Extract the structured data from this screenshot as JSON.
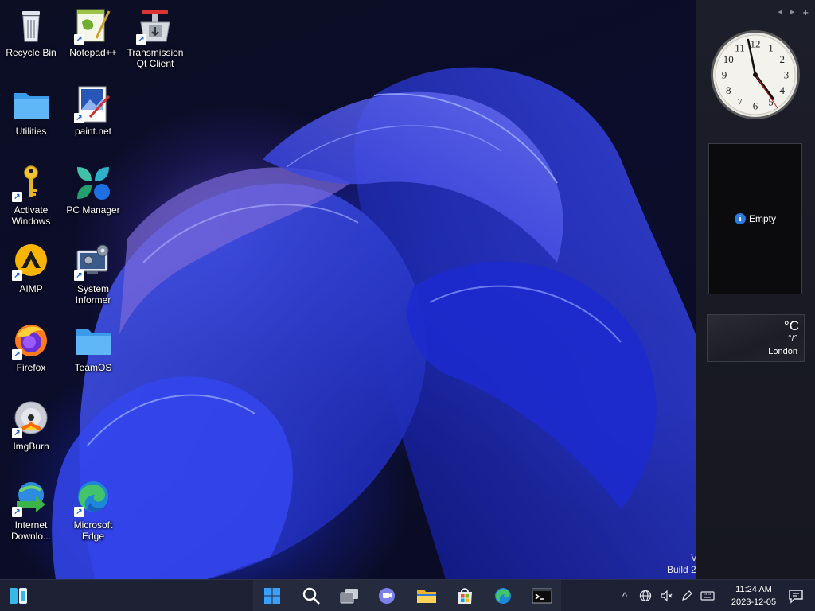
{
  "desktop": {
    "icons": [
      {
        "label": "Recycle Bin",
        "icon": "recycle-bin-icon"
      },
      {
        "label": "Notepad++",
        "icon": "notepad-plus-plus-icon"
      },
      {
        "label": "Transmission Qt Client",
        "icon": "transmission-icon"
      },
      {
        "label": "Utilities",
        "icon": "folder-icon"
      },
      {
        "label": "paint.net",
        "icon": "paint-net-icon"
      },
      {
        "label": "Activate Windows",
        "icon": "key-icon"
      },
      {
        "label": "PC Manager",
        "icon": "pc-manager-icon"
      },
      {
        "label": "AIMP",
        "icon": "aimp-icon"
      },
      {
        "label": "System Informer",
        "icon": "system-informer-icon"
      },
      {
        "label": "Firefox",
        "icon": "firefox-icon"
      },
      {
        "label": "TeamOS",
        "icon": "folder-icon"
      },
      {
        "label": "ImgBurn",
        "icon": "imgburn-icon"
      },
      {
        "label": "Internet Downlo...",
        "icon": "internet-download-manager-icon"
      },
      {
        "label": "Microsoft Edge",
        "icon": "edge-icon"
      }
    ],
    "build_text": "Build 2",
    "build_fragment": "V"
  },
  "sidebar": {
    "controls": {
      "prev": "◂",
      "next": "▸",
      "add": "+"
    },
    "clock_numbers": [
      "12",
      "1",
      "2",
      "3",
      "4",
      "5",
      "6",
      "7",
      "8",
      "9",
      "10",
      "11"
    ],
    "slideshow_empty": "Empty",
    "info_glyph": "i",
    "weather": {
      "unit": "°C",
      "temp": "°/°",
      "city": "London"
    }
  },
  "taskbar": {
    "pinned": [
      {
        "name": "start-button",
        "icon": "windows-logo-icon"
      },
      {
        "name": "search-button",
        "icon": "search-icon"
      },
      {
        "name": "task-view-button",
        "icon": "task-view-icon"
      },
      {
        "name": "chat-button",
        "icon": "teams-chat-icon"
      },
      {
        "name": "file-explorer-button",
        "icon": "folder-icon"
      },
      {
        "name": "store-button",
        "icon": "microsoft-store-icon"
      },
      {
        "name": "edge-button",
        "icon": "edge-icon"
      },
      {
        "name": "terminal-button",
        "icon": "terminal-icon"
      }
    ],
    "tray": {
      "chevron": "^",
      "time": "11:24 AM",
      "date": "2023-12-05"
    }
  }
}
